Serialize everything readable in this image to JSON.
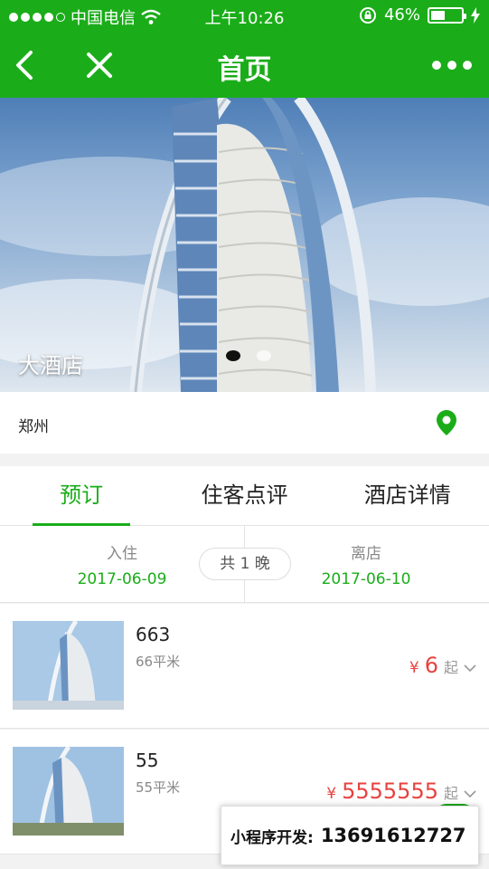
{
  "status_bar": {
    "carrier": "中国电信",
    "time": "上午10:26",
    "battery_percent": "46%",
    "battery_level": 0.46,
    "signal_bars": 4
  },
  "nav": {
    "title": "首页",
    "icons": {
      "back": "back-icon",
      "close": "close-icon",
      "more": "more-icon"
    }
  },
  "hero": {
    "title": "大酒店",
    "slide_count": 2,
    "active_slide": 1
  },
  "location": {
    "city": "郑州",
    "icon": "location-pin-icon"
  },
  "tabs": [
    {
      "label": "预订",
      "active": true
    },
    {
      "label": "住客点评",
      "active": false
    },
    {
      "label": "酒店详情",
      "active": false
    }
  ],
  "dates": {
    "checkin_label": "入住",
    "checkin_date": "2017-06-09",
    "checkout_label": "离店",
    "checkout_date": "2017-06-10",
    "nights": "共 1 晚"
  },
  "rooms": [
    {
      "name": "663",
      "area": "66平米",
      "currency": "¥",
      "price": "6",
      "suffix": "起"
    },
    {
      "name": "55",
      "area": "55平米",
      "currency": "¥",
      "price": "5555555",
      "suffix": "起"
    }
  ],
  "promo": {
    "label": "小程序开发:",
    "phone": "13691612727"
  },
  "colors": {
    "brand_green": "#1aad19",
    "price_red": "#e64340"
  }
}
